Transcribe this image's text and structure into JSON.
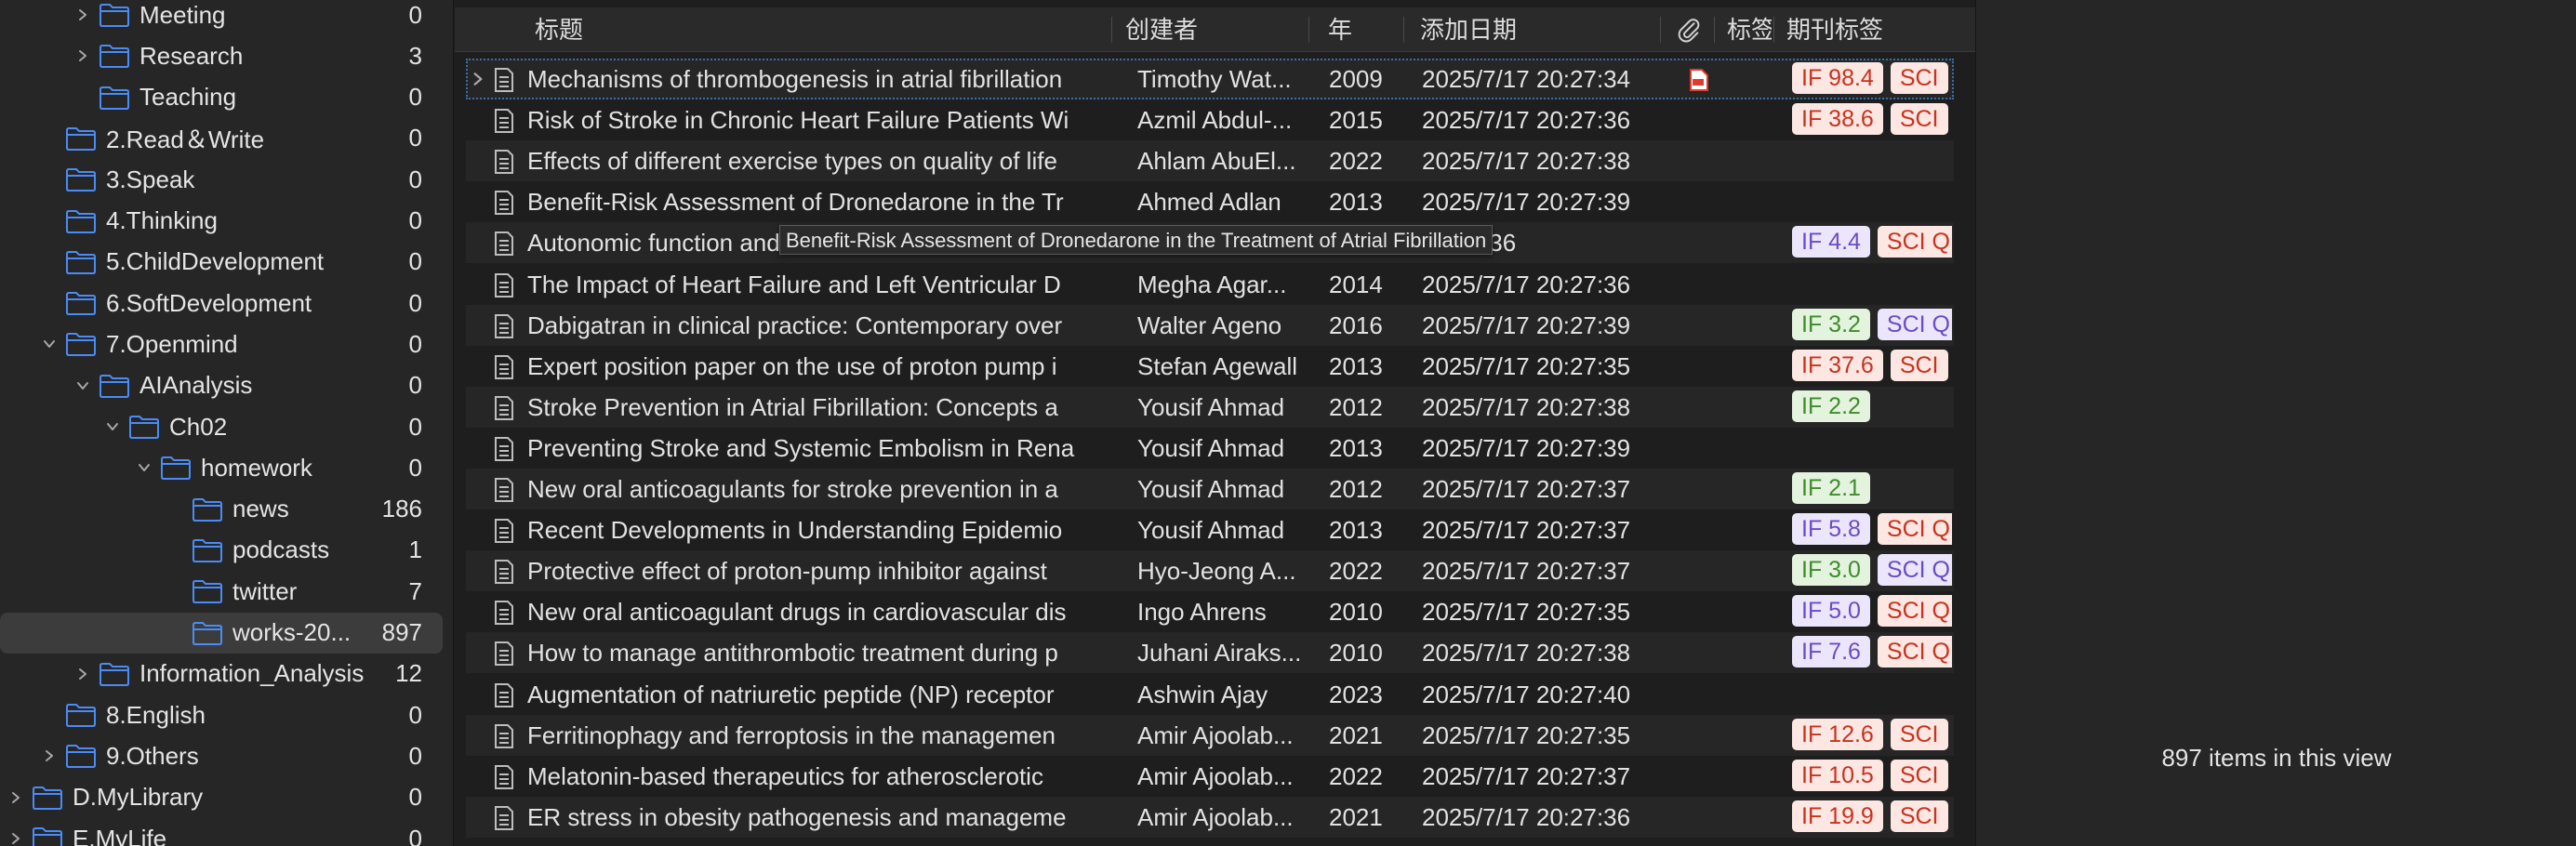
{
  "sidebar": {
    "items": [
      {
        "label": "Meeting",
        "count": "0",
        "level": 2,
        "expandable": true,
        "expanded": false
      },
      {
        "label": "Research",
        "count": "3",
        "level": 2,
        "expandable": true,
        "expanded": false
      },
      {
        "label": "Teaching",
        "count": "0",
        "level": 2,
        "expandable": false,
        "expanded": false
      },
      {
        "label": "2.Read＆Write",
        "count": "0",
        "level": 1,
        "expandable": false,
        "expanded": false
      },
      {
        "label": "3.Speak",
        "count": "0",
        "level": 1,
        "expandable": false,
        "expanded": false
      },
      {
        "label": "4.Thinking",
        "count": "0",
        "level": 1,
        "expandable": false,
        "expanded": false
      },
      {
        "label": "5.ChildDevelopment",
        "count": "0",
        "level": 1,
        "expandable": false,
        "expanded": false
      },
      {
        "label": "6.SoftDevelopment",
        "count": "0",
        "level": 1,
        "expandable": false,
        "expanded": false
      },
      {
        "label": "7.Openmind",
        "count": "0",
        "level": 1,
        "expandable": true,
        "expanded": true
      },
      {
        "label": "AIAnalysis",
        "count": "0",
        "level": 2,
        "expandable": true,
        "expanded": true
      },
      {
        "label": "Ch02",
        "count": "0",
        "level": 3,
        "expandable": true,
        "expanded": true
      },
      {
        "label": "homework",
        "count": "0",
        "level": 4,
        "expandable": true,
        "expanded": true
      },
      {
        "label": "news",
        "count": "186",
        "level": 5,
        "expandable": false,
        "expanded": false
      },
      {
        "label": "podcasts",
        "count": "1",
        "level": 5,
        "expandable": false,
        "expanded": false
      },
      {
        "label": "twitter",
        "count": "7",
        "level": 5,
        "expandable": false,
        "expanded": false
      },
      {
        "label": "works-20...",
        "count": "897",
        "level": 5,
        "expandable": false,
        "expanded": false,
        "selected": true
      },
      {
        "label": "Information_Analysis",
        "count": "12",
        "level": 2,
        "expandable": true,
        "expanded": false
      },
      {
        "label": "8.English",
        "count": "0",
        "level": 1,
        "expandable": false,
        "expanded": false
      },
      {
        "label": "9.Others",
        "count": "0",
        "level": 1,
        "expandable": true,
        "expanded": false
      },
      {
        "label": "D.MyLibrary",
        "count": "0",
        "level": 0,
        "expandable": true,
        "expanded": false
      },
      {
        "label": "E.MyLife",
        "count": "0",
        "level": 0,
        "expandable": true,
        "expanded": false
      }
    ]
  },
  "table": {
    "headers": {
      "title": "标题",
      "creator": "创建者",
      "year": "年",
      "date_added": "添加日期",
      "attachment_icon": "paperclip-icon",
      "tags": "标签",
      "journal_tags": "期刊标签"
    },
    "rows": [
      {
        "title": "Mechanisms of thrombogenesis in atrial fibrillation",
        "creator": "Timothy Wat...",
        "year": "2009",
        "date": "2025/7/17 20:27:34",
        "pdf": true,
        "expandable": true,
        "selected": true,
        "tags": [
          {
            "text": "IF 98.4",
            "style": "if-red"
          },
          {
            "text": "SCI",
            "style": "sci-red"
          }
        ]
      },
      {
        "title": "Risk of Stroke in Chronic Heart Failure Patients Wi",
        "creator": "Azmil Abdul-...",
        "year": "2015",
        "date": "2025/7/17 20:27:36",
        "tags": [
          {
            "text": "IF 38.6",
            "style": "if-red"
          },
          {
            "text": "SCI",
            "style": "sci-red"
          }
        ]
      },
      {
        "title": "Effects of different exercise types on quality of life",
        "creator": "Ahlam AbuEl...",
        "year": "2022",
        "date": "2025/7/17 20:27:38",
        "tags": []
      },
      {
        "title": "Benefit-Risk Assessment of Dronedarone in the Tr",
        "creator": "Ahmed Adlan",
        "year": "2013",
        "date": "2025/7/17 20:27:39",
        "tags": []
      },
      {
        "title": "Autonomic function and",
        "creator": "",
        "year": "",
        "date": "20:27:36",
        "tags": [
          {
            "text": "IF 4.4",
            "style": "if-purple"
          },
          {
            "text": "SCI Q",
            "style": "sci-red"
          }
        ]
      },
      {
        "title": "The Impact of Heart Failure and Left Ventricular D",
        "creator": "Megha Agar...",
        "year": "2014",
        "date": "2025/7/17 20:27:36",
        "tags": []
      },
      {
        "title": "Dabigatran in clinical practice: Contemporary over",
        "creator": "Walter Ageno",
        "year": "2016",
        "date": "2025/7/17 20:27:39",
        "tags": [
          {
            "text": "IF 3.2",
            "style": "if-green"
          },
          {
            "text": "SCI Q",
            "style": "sci-purple"
          }
        ]
      },
      {
        "title": "Expert position paper on the use of proton pump i",
        "creator": "Stefan Agewall",
        "year": "2013",
        "date": "2025/7/17 20:27:35",
        "tags": [
          {
            "text": "IF 37.6",
            "style": "if-red"
          },
          {
            "text": "SCI",
            "style": "sci-red"
          }
        ]
      },
      {
        "title": "Stroke Prevention in Atrial Fibrillation: Concepts a",
        "creator": "Yousif Ahmad",
        "year": "2012",
        "date": "2025/7/17 20:27:38",
        "tags": [
          {
            "text": "IF 2.2",
            "style": "if-green"
          }
        ]
      },
      {
        "title": "Preventing Stroke and Systemic Embolism in Rena",
        "creator": "Yousif Ahmad",
        "year": "2013",
        "date": "2025/7/17 20:27:39",
        "tags": []
      },
      {
        "title": "New oral anticoagulants for stroke prevention in a",
        "creator": "Yousif Ahmad",
        "year": "2012",
        "date": "2025/7/17 20:27:37",
        "tags": [
          {
            "text": "IF 2.1",
            "style": "if-green"
          }
        ]
      },
      {
        "title": "Recent Developments in Understanding Epidemio",
        "creator": "Yousif Ahmad",
        "year": "2013",
        "date": "2025/7/17 20:27:37",
        "tags": [
          {
            "text": "IF 5.8",
            "style": "if-purple"
          },
          {
            "text": "SCI Q",
            "style": "sci-red"
          }
        ]
      },
      {
        "title": "Protective effect of proton-pump inhibitor against",
        "creator": "Hyo-Jeong A...",
        "year": "2022",
        "date": "2025/7/17 20:27:37",
        "tags": [
          {
            "text": "IF 3.0",
            "style": "if-green"
          },
          {
            "text": "SCI Q",
            "style": "sci-purple"
          }
        ]
      },
      {
        "title": "New oral anticoagulant drugs in cardiovascular dis",
        "creator": "Ingo Ahrens",
        "year": "2010",
        "date": "2025/7/17 20:27:35",
        "tags": [
          {
            "text": "IF 5.0",
            "style": "if-purple"
          },
          {
            "text": "SCI Q",
            "style": "sci-red"
          }
        ]
      },
      {
        "title": "How to manage antithrombotic treatment during p",
        "creator": "Juhani Airaks...",
        "year": "2010",
        "date": "2025/7/17 20:27:38",
        "tags": [
          {
            "text": "IF 7.6",
            "style": "if-purple"
          },
          {
            "text": "SCI Q",
            "style": "sci-red"
          }
        ]
      },
      {
        "title": "Augmentation of natriuretic peptide (NP) receptor",
        "creator": "Ashwin Ajay",
        "year": "2023",
        "date": "2025/7/17 20:27:40",
        "tags": []
      },
      {
        "title": "Ferritinophagy and ferroptosis in the managemen",
        "creator": "Amir Ajoolab...",
        "year": "2021",
        "date": "2025/7/17 20:27:35",
        "tags": [
          {
            "text": "IF 12.6",
            "style": "if-red"
          },
          {
            "text": "SCI",
            "style": "sci-red"
          }
        ]
      },
      {
        "title": "Melatonin-based therapeutics for atherosclerotic",
        "creator": "Amir Ajoolab...",
        "year": "2022",
        "date": "2025/7/17 20:27:37",
        "tags": [
          {
            "text": "IF 10.5",
            "style": "if-red"
          },
          {
            "text": "SCI",
            "style": "sci-red"
          }
        ]
      },
      {
        "title": "ER stress in obesity pathogenesis and manageme",
        "creator": "Amir Ajoolab...",
        "year": "2021",
        "date": "2025/7/17 20:27:36",
        "tags": [
          {
            "text": "IF 19.9",
            "style": "if-red"
          },
          {
            "text": "SCI",
            "style": "sci-red"
          }
        ]
      }
    ]
  },
  "tooltip": {
    "text": "Benefit-Risk Assessment of Dronedarone in the Treatment of Atrial Fibrillation"
  },
  "right_pane": {
    "items_count_text": "897 items in this view"
  },
  "colors": {
    "folder": "#4a8cf5",
    "selection": "#3c3c3c",
    "pdf": "#e03b2b"
  }
}
